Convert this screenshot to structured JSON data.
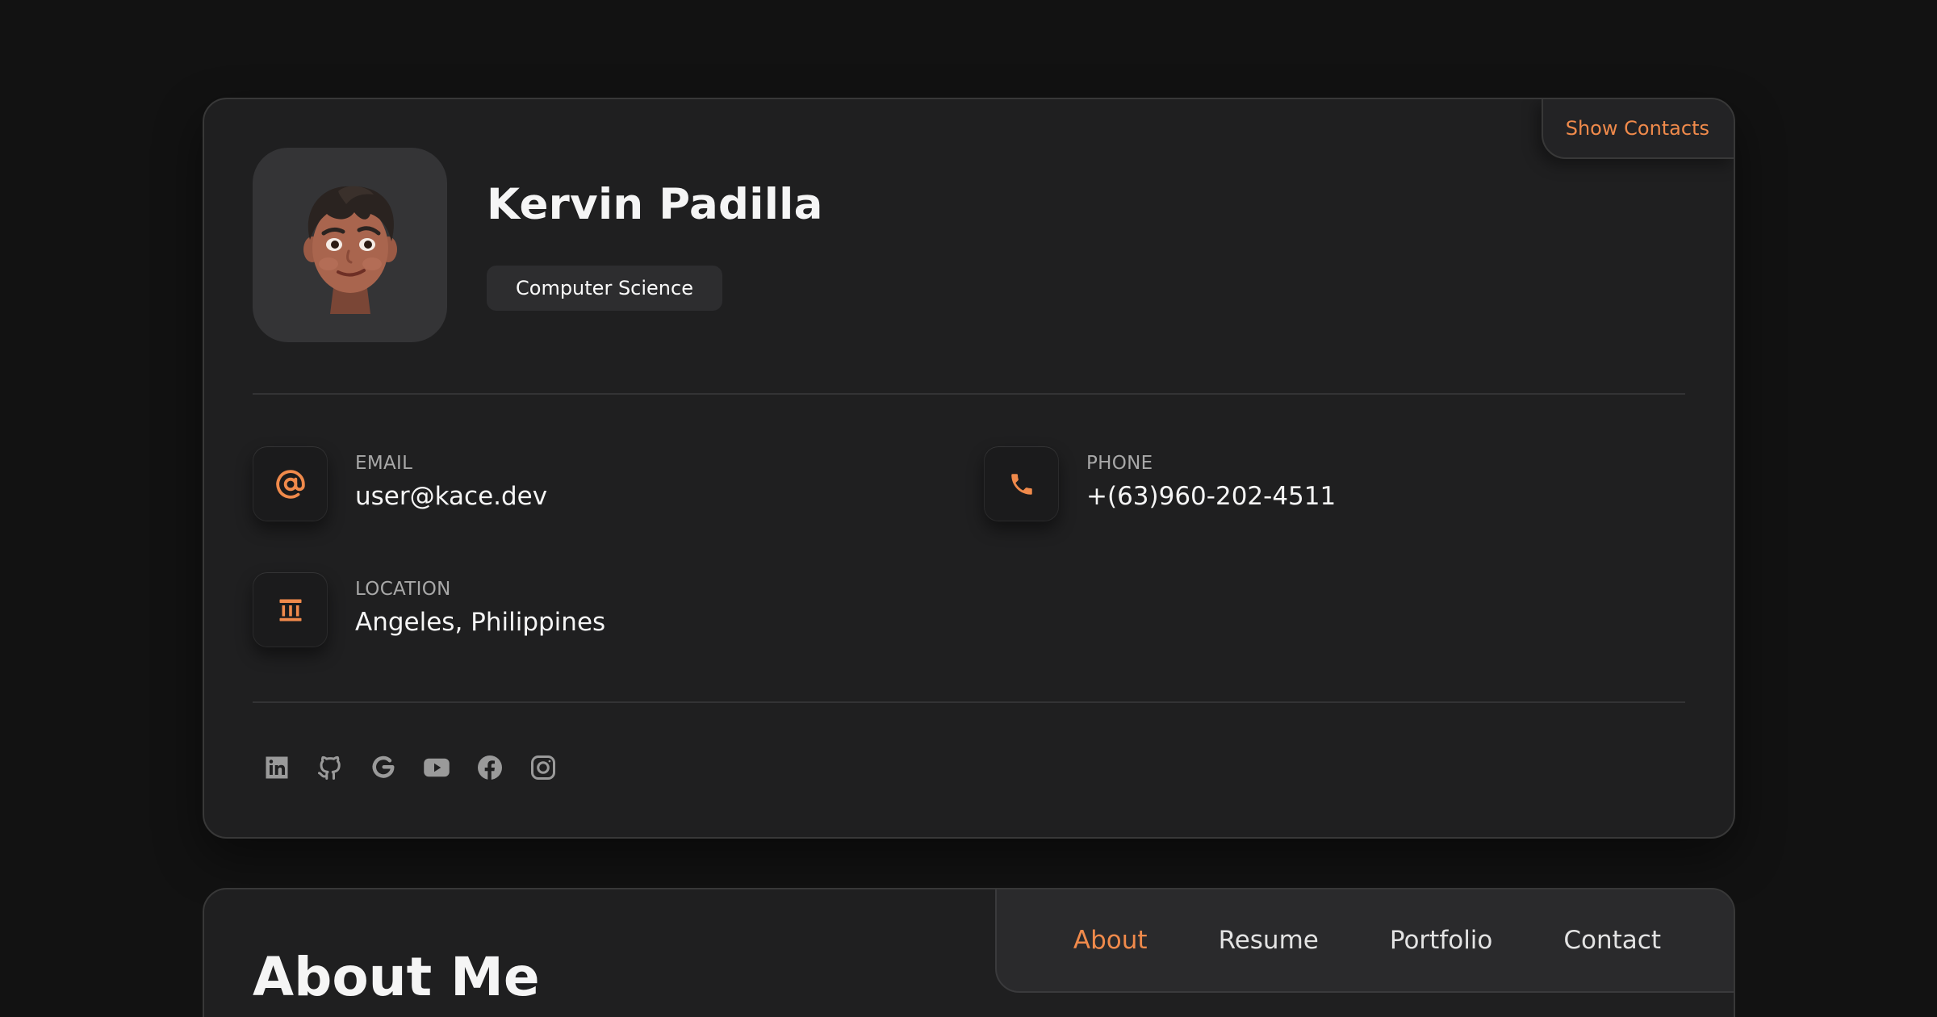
{
  "profile": {
    "name": "Kervin Padilla",
    "title": "Computer Science",
    "avatar_icon": "memoji-avatar",
    "show_contacts_label": "Show Contacts"
  },
  "contacts": {
    "email": {
      "label": "EMAIL",
      "value": "user@kace.dev",
      "icon": "at-sign-icon"
    },
    "phone": {
      "label": "PHONE",
      "value": "+(63)960-202-4511",
      "icon": "phone-icon"
    },
    "location": {
      "label": "LOCATION",
      "value": "Angeles, Philippines",
      "icon": "landmark-icon"
    }
  },
  "social": [
    "linkedin-icon",
    "github-icon",
    "google-icon",
    "youtube-icon",
    "facebook-icon",
    "instagram-icon"
  ],
  "about": {
    "title": "About Me"
  },
  "nav": {
    "items": [
      "About",
      "Resume",
      "Portfolio",
      "Contact"
    ],
    "active": "About"
  },
  "colors": {
    "accent": "#f08a4b",
    "background": "#121212",
    "card": "#1f1f20"
  }
}
